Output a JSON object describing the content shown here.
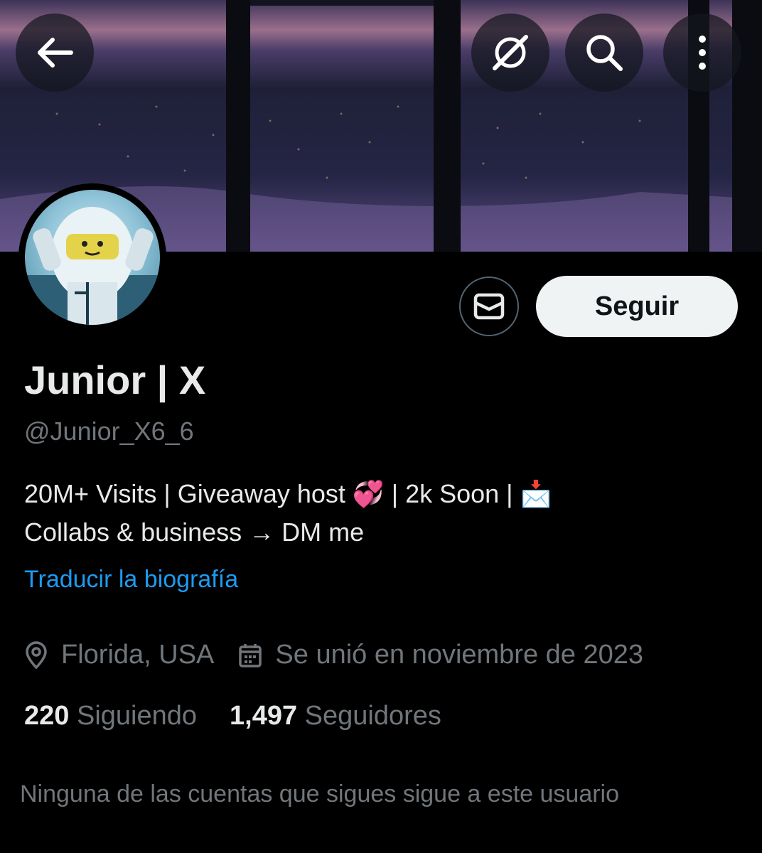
{
  "topbar": {
    "back_icon": "arrow-left-icon",
    "grok_icon": "grok-icon",
    "search_icon": "search-icon",
    "more_icon": "more-vertical-icon"
  },
  "profile": {
    "display_name": "Junior | X",
    "handle": "@Junior_X6_6",
    "bio_line1_a": "20M+ Visits | Giveaway host ",
    "bio_emoji1": "💞",
    "bio_line1_b": " | 2k Soon | ",
    "bio_emoji2": "📩",
    "bio_line2": "Collabs & business → DM me",
    "translate_link": "Traducir la biografía",
    "location": "Florida, USA",
    "joined": "Se unió en noviembre de 2023",
    "following_count": "220",
    "following_label": "Siguiendo",
    "followers_count": "1,497",
    "followers_label": "Seguidores",
    "mutual_text": "Ninguna de las cuentas que sigues sigue a este usuario"
  },
  "actions": {
    "message_icon": "envelope-icon",
    "follow_label": "Seguir"
  },
  "colors": {
    "background": "#000000",
    "primary_text": "#e7e9ea",
    "secondary_text": "#71767b",
    "link": "#1d9bf0",
    "follow_bg": "#eff3f4"
  }
}
